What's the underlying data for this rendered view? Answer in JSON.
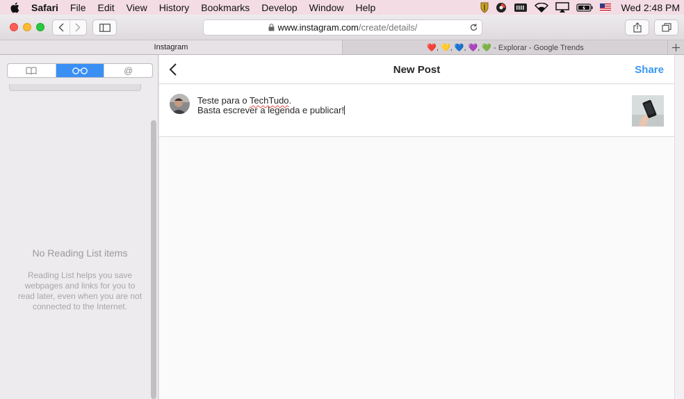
{
  "menubar": {
    "items": [
      "Safari",
      "File",
      "Edit",
      "View",
      "History",
      "Bookmarks",
      "Develop",
      "Window",
      "Help"
    ],
    "clock": "Wed 2:48 PM"
  },
  "toolbar": {
    "url_host": "www.instagram.com",
    "url_path": "/create/details/"
  },
  "tabs": {
    "items": [
      {
        "label": "Instagram",
        "active": true
      },
      {
        "label": "❤️, 💛, 💙, 💜, 💚 - Explorar - Google Trends",
        "active": false
      }
    ]
  },
  "sidebar": {
    "segments": [
      {
        "icon": "bookmarks-book-icon",
        "active": false
      },
      {
        "icon": "reading-list-glasses-icon",
        "active": true
      },
      {
        "icon": "shared-links-at-icon",
        "active": false
      }
    ],
    "empty_title": "No Reading List items",
    "empty_desc": "Reading List helps you save webpages and links for you to read later, even when you are not connected to the Internet."
  },
  "instagram": {
    "title": "New Post",
    "share_label": "Share",
    "caption_line1_a": "Teste para o ",
    "caption_line1_b": "TechTudo",
    "caption_line1_c": ".",
    "caption_line2": "Basta escrever a legenda e publicar!"
  },
  "colors": {
    "accent": "#3897f0",
    "segment_active": "#3a8ff5",
    "menubar": "#f3dce4"
  }
}
